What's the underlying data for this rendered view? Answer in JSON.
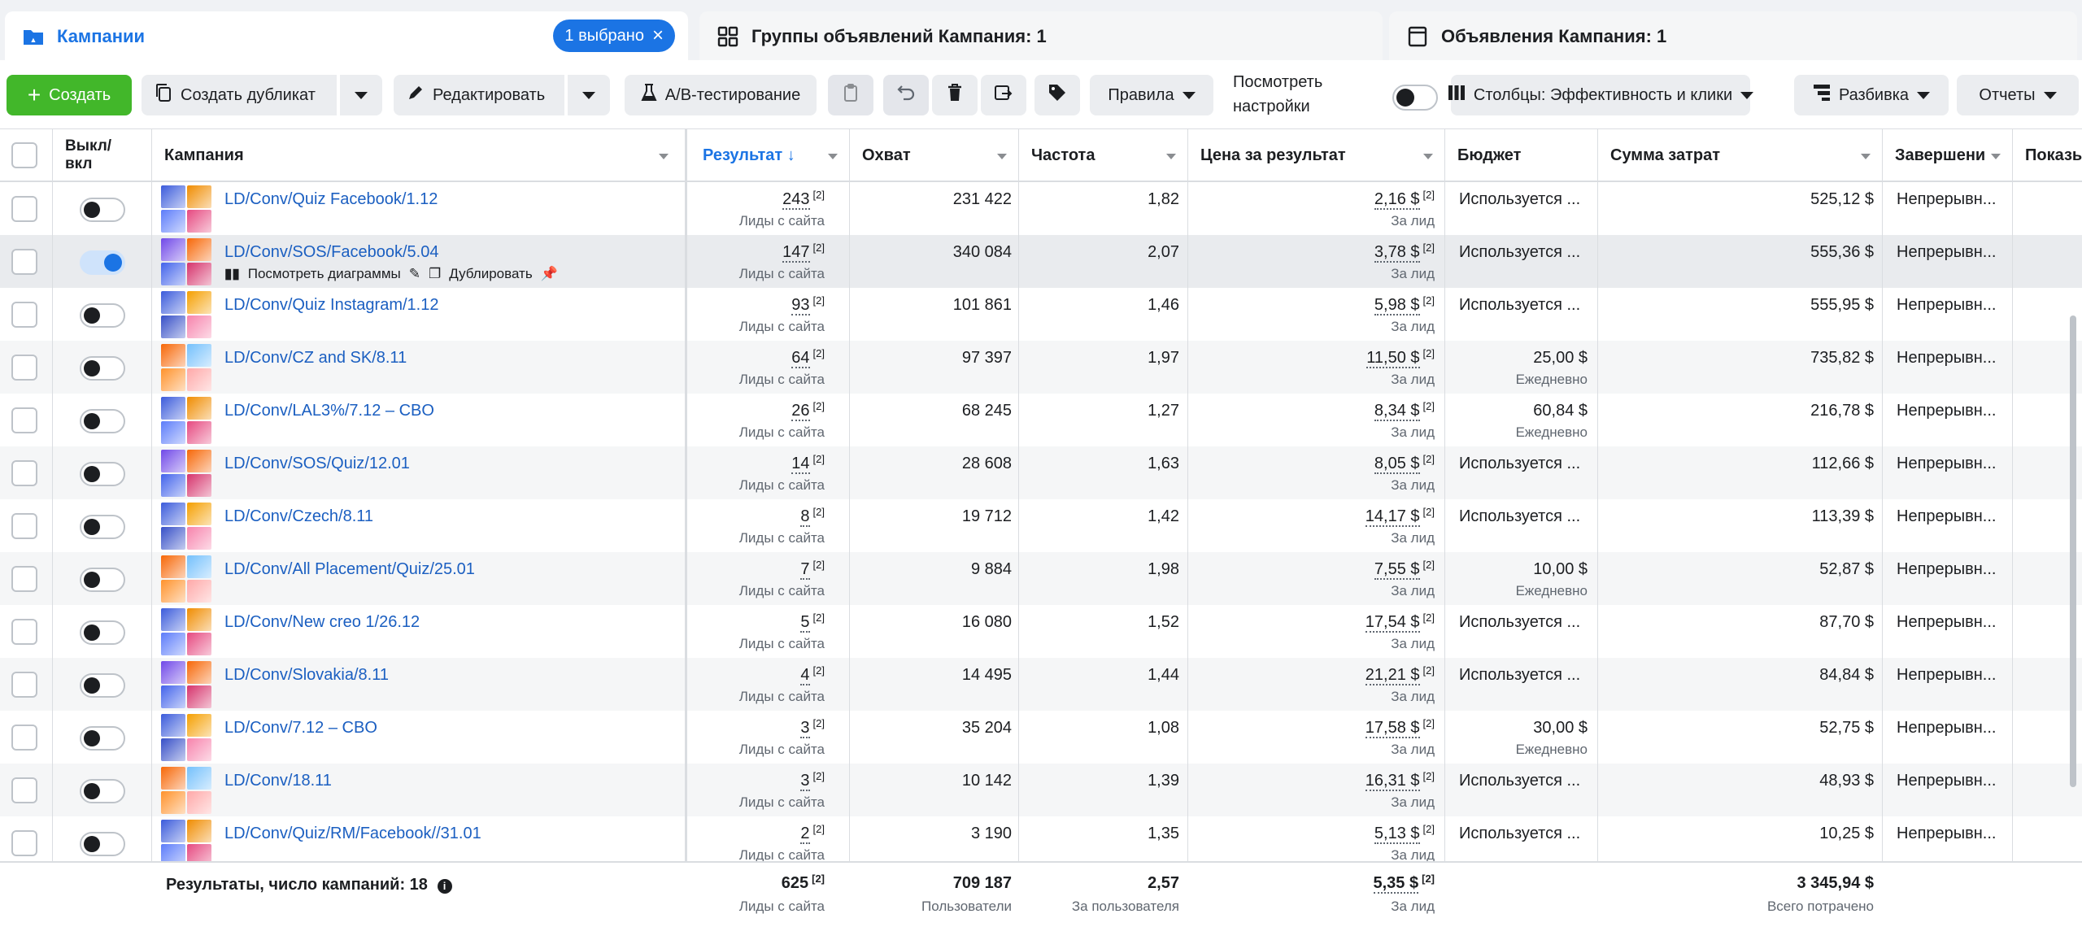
{
  "tabs": {
    "campaigns": {
      "label": "Кампании",
      "chip": "1 выбрано"
    },
    "adsets": {
      "label": "Группы объявлений Кампания: 1"
    },
    "ads": {
      "label": "Объявления Кампания: 1"
    }
  },
  "toolbar": {
    "create": "Создать",
    "duplicate": "Создать дубликат",
    "edit": "Редактировать",
    "ab_test": "A/B-тестирование",
    "rules": "Правила",
    "view_settings_line1": "Посмотреть",
    "view_settings_line2": "настройки",
    "columns": "Столбцы: Эффективность и клики",
    "breakdown": "Разбивка",
    "reports": "Отчеты"
  },
  "headers": {
    "toggle": "Выкл/\nвкл",
    "campaign": "Кампания",
    "result": "Результат ↓",
    "reach": "Охват",
    "frequency": "Частота",
    "cost": "Цена за результат",
    "budget": "Бюджет",
    "spent": "Сумма затрат",
    "end": "Завершени",
    "impressions": "Показь"
  },
  "row_actions": {
    "charts": "Посмотреть диаграммы",
    "duplicate": "Дублировать"
  },
  "rows": [
    {
      "name": "LD/Conv/Quiz Facebook/1.12",
      "result": "243",
      "result_sub": "Лиды с сайта",
      "reach": "231 422",
      "freq": "1,82",
      "cost": "2,16 $",
      "cost_sub": "За лид",
      "budget": "Используется ...",
      "budget_sub": "",
      "spent": "525,12 $",
      "end": "Непрерывн...",
      "on": false
    },
    {
      "name": "LD/Conv/SOS/Facebook/5.04",
      "result": "147",
      "result_sub": "Лиды с сайта",
      "reach": "340 084",
      "freq": "2,07",
      "cost": "3,78 $",
      "cost_sub": "За лид",
      "budget": "Используется ...",
      "budget_sub": "",
      "spent": "555,36 $",
      "end": "Непрерывн...",
      "on": true
    },
    {
      "name": "LD/Conv/Quiz Instagram/1.12",
      "result": "93",
      "result_sub": "Лиды с сайта",
      "reach": "101 861",
      "freq": "1,46",
      "cost": "5,98 $",
      "cost_sub": "За лид",
      "budget": "Используется ...",
      "budget_sub": "",
      "spent": "555,95 $",
      "end": "Непрерывн...",
      "on": false
    },
    {
      "name": "LD/Conv/CZ and SK/8.11",
      "result": "64",
      "result_sub": "Лиды с сайта",
      "reach": "97 397",
      "freq": "1,97",
      "cost": "11,50 $",
      "cost_sub": "За лид",
      "budget": "25,00 $",
      "budget_sub": "Ежедневно",
      "spent": "735,82 $",
      "end": "Непрерывн...",
      "on": false
    },
    {
      "name": "LD/Conv/LAL3%/7.12 – CBO",
      "result": "26",
      "result_sub": "Лиды с сайта",
      "reach": "68 245",
      "freq": "1,27",
      "cost": "8,34 $",
      "cost_sub": "За лид",
      "budget": "60,84 $",
      "budget_sub": "Ежедневно",
      "spent": "216,78 $",
      "end": "Непрерывн...",
      "on": false
    },
    {
      "name": "LD/Conv/SOS/Quiz/12.01",
      "result": "14",
      "result_sub": "Лиды с сайта",
      "reach": "28 608",
      "freq": "1,63",
      "cost": "8,05 $",
      "cost_sub": "За лид",
      "budget": "Используется ...",
      "budget_sub": "",
      "spent": "112,66 $",
      "end": "Непрерывн...",
      "on": false
    },
    {
      "name": "LD/Conv/Czech/8.11",
      "result": "8",
      "result_sub": "Лиды с сайта",
      "reach": "19 712",
      "freq": "1,42",
      "cost": "14,17 $",
      "cost_sub": "За лид",
      "budget": "Используется ...",
      "budget_sub": "",
      "spent": "113,39 $",
      "end": "Непрерывн...",
      "on": false
    },
    {
      "name": "LD/Conv/All Placement/Quiz/25.01",
      "result": "7",
      "result_sub": "Лиды с сайта",
      "reach": "9 884",
      "freq": "1,98",
      "cost": "7,55 $",
      "cost_sub": "За лид",
      "budget": "10,00 $",
      "budget_sub": "Ежедневно",
      "spent": "52,87 $",
      "end": "Непрерывн...",
      "on": false
    },
    {
      "name": "LD/Conv/New creo 1/26.12",
      "result": "5",
      "result_sub": "Лиды с сайта",
      "reach": "16 080",
      "freq": "1,52",
      "cost": "17,54 $",
      "cost_sub": "За лид",
      "budget": "Используется ...",
      "budget_sub": "",
      "spent": "87,70 $",
      "end": "Непрерывн...",
      "on": false
    },
    {
      "name": "LD/Conv/Slovakia/8.11",
      "result": "4",
      "result_sub": "Лиды с сайта",
      "reach": "14 495",
      "freq": "1,44",
      "cost": "21,21 $",
      "cost_sub": "За лид",
      "budget": "Используется ...",
      "budget_sub": "",
      "spent": "84,84 $",
      "end": "Непрерывн...",
      "on": false
    },
    {
      "name": "LD/Conv/7.12 – CBO",
      "result": "3",
      "result_sub": "Лиды с сайта",
      "reach": "35 204",
      "freq": "1,08",
      "cost": "17,58 $",
      "cost_sub": "За лид",
      "budget": "30,00 $",
      "budget_sub": "Ежедневно",
      "spent": "52,75 $",
      "end": "Непрерывн...",
      "on": false
    },
    {
      "name": "LD/Conv/18.11",
      "result": "3",
      "result_sub": "Лиды с сайта",
      "reach": "10 142",
      "freq": "1,39",
      "cost": "16,31 $",
      "cost_sub": "За лид",
      "budget": "Используется ...",
      "budget_sub": "",
      "spent": "48,93 $",
      "end": "Непрерывн...",
      "on": false
    },
    {
      "name": "LD/Conv/Quiz/RM/Facebook//31.01",
      "result": "2",
      "result_sub": "Лиды с сайта",
      "reach": "3 190",
      "freq": "1,35",
      "cost": "5,13 $",
      "cost_sub": "За лид",
      "budget": "Используется ...",
      "budget_sub": "",
      "spent": "10,25 $",
      "end": "Непрерывн...",
      "on": false
    }
  ],
  "footer": {
    "label": "Результаты, число кампаний: 18",
    "result": "625",
    "result_sub": "Лиды с сайта",
    "reach": "709 187",
    "reach_sub": "Пользователи",
    "freq": "2,57",
    "freq_sub": "За пользователя",
    "cost": "5,35 $",
    "cost_sub": "За лид",
    "spent": "3 345,94 $",
    "spent_sub": "Всего потрачено"
  },
  "colors": {
    "accent": "#1b74e4",
    "create": "#42b72a",
    "link": "#1b5fc1"
  }
}
